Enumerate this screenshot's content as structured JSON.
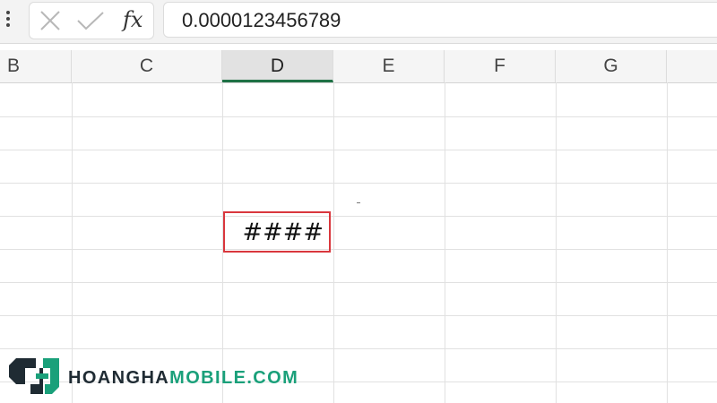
{
  "formula_bar": {
    "fx_label": "fx",
    "value": "0.0000123456789",
    "cancel_icon": "close-icon",
    "enter_icon": "check-icon"
  },
  "columns": [
    "B",
    "C",
    "D",
    "E",
    "F",
    "G"
  ],
  "active_column": "D",
  "active_cell": {
    "display": "####",
    "border_color": "#d9373d"
  },
  "logo": {
    "text_dark": "HOANGHA",
    "text_green": "MOBILE.COM",
    "brand_dark": "#1f2b33",
    "brand_green": "#1aa07a"
  },
  "colors": {
    "header_active_underline": "#1e7145",
    "grid_line": "#e1e1e1"
  }
}
